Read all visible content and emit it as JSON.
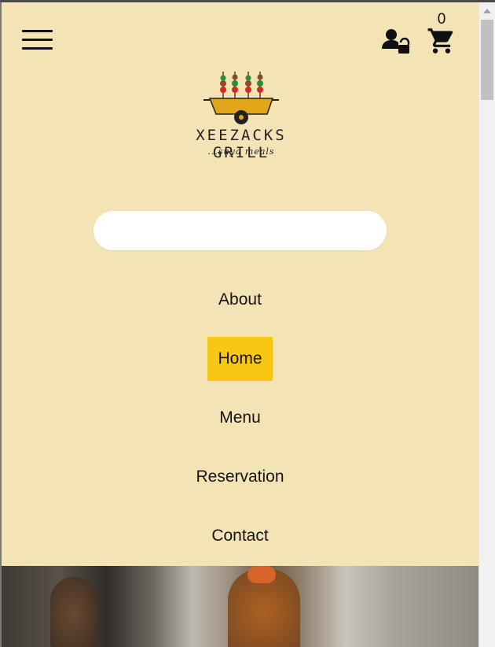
{
  "header": {
    "menu_icon": "hamburger-menu-icon",
    "user_icon": "user-lock-icon",
    "cart_icon": "shopping-cart-icon",
    "cart_count": "0"
  },
  "logo": {
    "brand": "XEEZACKS GRILL",
    "tagline": "...suya meals"
  },
  "search": {
    "value": "",
    "placeholder": ""
  },
  "nav": {
    "items": [
      {
        "label": "About"
      },
      {
        "label": "Home"
      },
      {
        "label": "Menu"
      },
      {
        "label": "Reservation"
      },
      {
        "label": "Contact"
      }
    ],
    "active": "Home"
  },
  "colors": {
    "background": "#f4e4b5",
    "accent": "#f8c614",
    "text": "#151515"
  }
}
